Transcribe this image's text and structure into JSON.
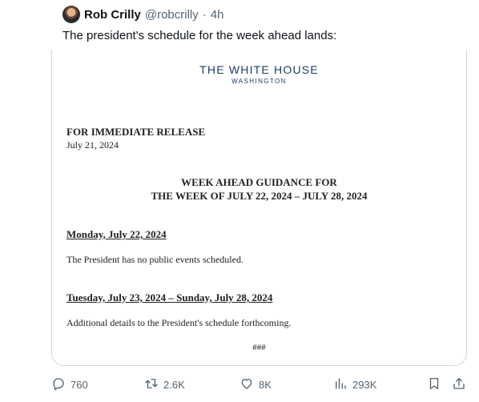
{
  "author": {
    "name": "Rob Crilly",
    "handle": "@robcrilly",
    "separator": "·",
    "time": "4h"
  },
  "tweet": {
    "text": "The president's schedule for the week ahead lands:"
  },
  "document": {
    "letterhead_title": "THE WHITE HOUSE",
    "letterhead_sub": "WASHINGTON",
    "release": "FOR IMMEDIATE RELEASE",
    "date": "July 21, 2024",
    "heading_line1": "WEEK AHEAD GUIDANCE FOR",
    "heading_line2": "THE WEEK OF JULY 22, 2024 – JULY 28, 2024",
    "day1_title": "Monday, July 22, 2024",
    "day1_text": "The President has no public events scheduled.",
    "day2_title": "Tuesday, July 23, 2024 – Sunday, July 28, 2024",
    "day2_text": "Additional details to the President's schedule forthcoming.",
    "end_mark": "###"
  },
  "actions": {
    "replies": "760",
    "reposts": "2.6K",
    "likes": "8K",
    "views": "293K"
  },
  "icons": {
    "reply": "reply-icon",
    "repost": "repost-icon",
    "like": "heart-icon",
    "views": "views-icon",
    "bookmark": "bookmark-icon",
    "share": "share-icon"
  }
}
